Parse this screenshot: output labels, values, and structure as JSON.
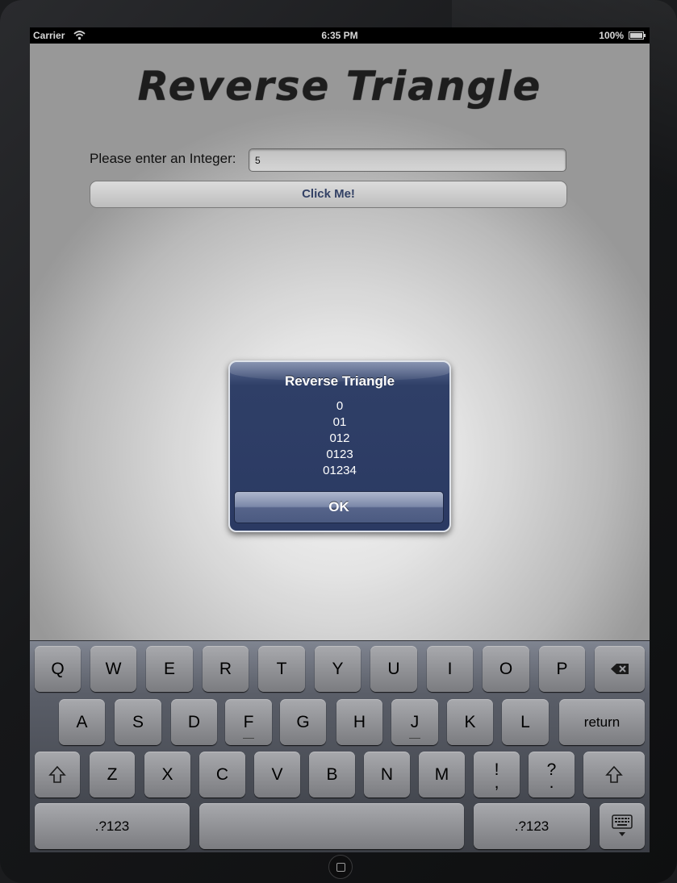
{
  "status_bar": {
    "carrier": "Carrier",
    "time": "6:35 PM",
    "battery": "100%"
  },
  "app": {
    "title": "Reverse Triangle",
    "prompt_label": "Please enter an Integer:",
    "input_value": "5",
    "button_label": "Click Me!"
  },
  "alert": {
    "title": "Reverse Triangle",
    "lines": [
      "0",
      "01",
      "012",
      "0123",
      "01234"
    ],
    "ok_label": "OK"
  },
  "keyboard": {
    "row1": [
      "Q",
      "W",
      "E",
      "R",
      "T",
      "Y",
      "U",
      "I",
      "O",
      "P"
    ],
    "row2": [
      "A",
      "S",
      "D",
      "F",
      "G",
      "H",
      "J",
      "K",
      "L"
    ],
    "row3": [
      "Z",
      "X",
      "C",
      "V",
      "B",
      "N",
      "M"
    ],
    "return_label": "return",
    "punct1_top": "!",
    "punct1_bottom": ",",
    "punct2_top": "?",
    "punct2_bottom": ".",
    "numbers_label": ".?123"
  },
  "icons": [
    "wifi-icon",
    "battery-icon",
    "backspace-icon",
    "shift-icon",
    "hide-keyboard-icon",
    "home-button"
  ]
}
